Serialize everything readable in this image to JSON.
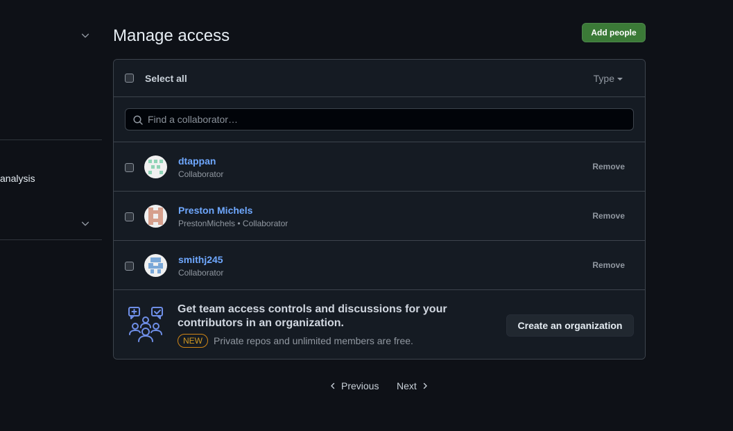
{
  "sidebar": {
    "partial_item_label": "analysis"
  },
  "header": {
    "title": "Manage access",
    "add_people_label": "Add people"
  },
  "list_header": {
    "select_all_label": "Select all",
    "type_filter_label": "Type"
  },
  "search": {
    "placeholder": "Find a collaborator…"
  },
  "collaborators": [
    {
      "name": "dtappan",
      "meta": "Collaborator",
      "remove_label": "Remove",
      "avatar_color": "#8fd3b6"
    },
    {
      "name": "Preston Michels",
      "meta": "PrestonMichels • Collaborator",
      "remove_label": "Remove",
      "avatar_color": "#d6a08d"
    },
    {
      "name": "smithj245",
      "meta": "Collaborator",
      "remove_label": "Remove",
      "avatar_color": "#7aa8d8"
    }
  ],
  "upsell": {
    "title": "Get team access controls and discussions for your contributors in an organization.",
    "badge": "NEW",
    "subtitle": "Private repos and unlimited members are free.",
    "button_label": "Create an organization"
  },
  "pagination": {
    "previous_label": "Previous",
    "next_label": "Next"
  },
  "colors": {
    "accent_link": "#6fa8ff",
    "primary_button": "#3b7a37",
    "badge": "#d29922"
  }
}
